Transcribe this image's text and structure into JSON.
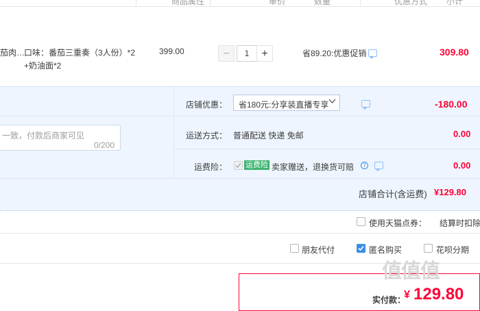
{
  "header": {
    "col_attrs": "商品属性",
    "col_price": "单价",
    "col_qty": "数量",
    "col_promo": "优惠方式",
    "col_subtotal": "小计"
  },
  "item": {
    "name_fragment": "茄肉…",
    "attr_line1": "口味：番茄三重奏（3人份）*2",
    "attr_line2": "+奶油面*2",
    "price": "399.00",
    "qty": "1",
    "minus": "−",
    "plus": "+",
    "promo": "省89.20:优惠促销",
    "subtotal": "309.80"
  },
  "shop": {
    "discount_label": "店铺优惠：",
    "discount_value": "省180元:分享装直播专享",
    "discount_amount": "-180.00",
    "memo_placeholder": "一致，付款后商家可见",
    "memo_count": "0/200",
    "shipping_label": "运送方式：",
    "shipping_value": "普通配送 快递 免邮",
    "shipping_amount": "0.00",
    "insurance_label": "运费险：",
    "insurance_tag": "运费险",
    "insurance_text": "卖家赠送，退换货可赔",
    "insurance_amount": "0.00",
    "total_label": "店铺合计(含运费)",
    "total_value": "¥129.80"
  },
  "points": {
    "label": "使用天猫点券：",
    "settle": "结算时扣除"
  },
  "pay_options": {
    "friend": "朋友代付",
    "anon": "匿名购买",
    "huabei": "花呗分期"
  },
  "final": {
    "label": "实付款：",
    "currency": "¥",
    "amount": "129.80"
  },
  "watermark": "值值值",
  "colors": {
    "accent": "#ff0036",
    "panel": "#eef5fe",
    "check": "#3a8fe6"
  }
}
